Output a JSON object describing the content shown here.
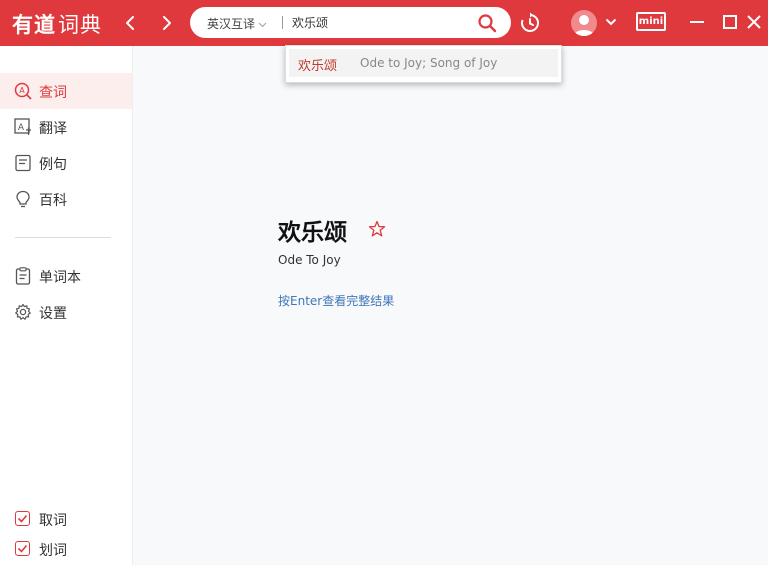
{
  "app": {
    "logo_main": "有道",
    "logo_sub": "词典"
  },
  "colors": {
    "brand": "#e0393d",
    "link": "#3f76b8",
    "active_bg": "#fdeeee"
  },
  "search": {
    "lang_mode": "英汉互译",
    "query": "欢乐颂"
  },
  "titlebar": {
    "mini_label": "mini"
  },
  "sidebar": {
    "items": [
      {
        "label": "查词",
        "icon": "search-word-icon",
        "active": true
      },
      {
        "label": "翻译",
        "icon": "translate-icon",
        "active": false
      },
      {
        "label": "例句",
        "icon": "example-sentence-icon",
        "active": false
      },
      {
        "label": "百科",
        "icon": "bulb-icon",
        "active": false
      }
    ],
    "tools": [
      {
        "label": "单词本",
        "icon": "wordbook-icon"
      },
      {
        "label": "设置",
        "icon": "gear-icon"
      }
    ],
    "checks": [
      {
        "label": "取词",
        "checked": true
      },
      {
        "label": "划词",
        "checked": true
      }
    ]
  },
  "result": {
    "word": "欢乐颂",
    "meaning": "Ode To Joy",
    "enter_hint": "按Enter查看完整结果"
  },
  "suggestion": {
    "word": "欢乐颂",
    "definition": "Ode to Joy; Song of Joy"
  }
}
